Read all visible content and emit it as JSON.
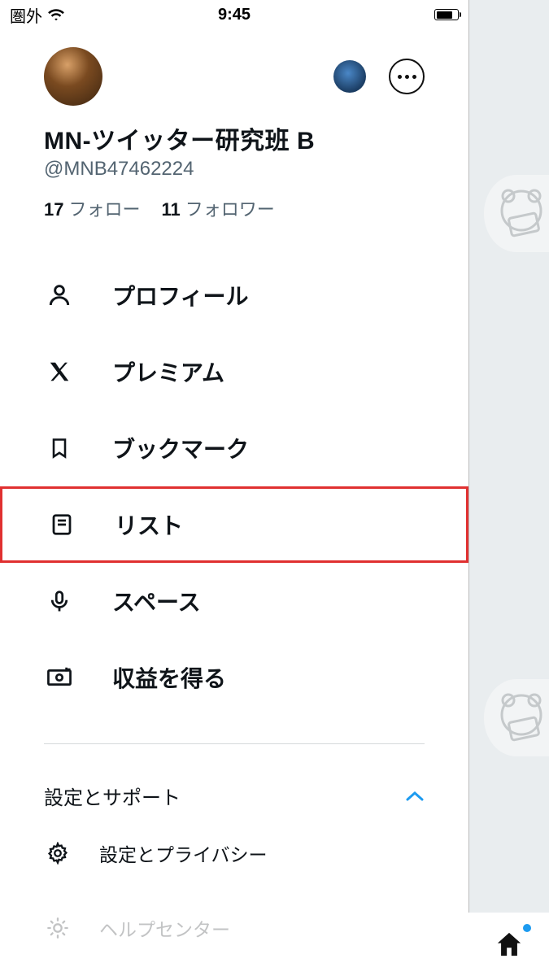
{
  "statusbar": {
    "carrier": "圏外",
    "time": "9:45"
  },
  "profile": {
    "display_name": "MN-ツイッター研究班 B",
    "handle": "@MNB47462224",
    "following_count": "17",
    "following_label": "フォロー",
    "followers_count": "11",
    "followers_label": "フォロワー"
  },
  "menu": [
    {
      "icon": "person-icon",
      "label": "プロフィール",
      "highlighted": false
    },
    {
      "icon": "x-icon",
      "label": "プレミアム",
      "highlighted": false
    },
    {
      "icon": "bookmark-icon",
      "label": "ブックマーク",
      "highlighted": false
    },
    {
      "icon": "list-icon",
      "label": "リスト",
      "highlighted": true
    },
    {
      "icon": "mic-icon",
      "label": "スペース",
      "highlighted": false
    },
    {
      "icon": "money-icon",
      "label": "収益を得る",
      "highlighted": false
    }
  ],
  "support": {
    "header": "設定とサポート",
    "expanded": true,
    "items": [
      {
        "icon": "gear-icon",
        "label": "設定とプライバシー",
        "faded": false
      },
      {
        "icon": "sun-icon",
        "label": "ヘルプセンター",
        "faded": true
      }
    ]
  },
  "colors": {
    "accent": "#1d9bf0",
    "highlight_border": "#e03030",
    "text_muted": "#536471"
  }
}
